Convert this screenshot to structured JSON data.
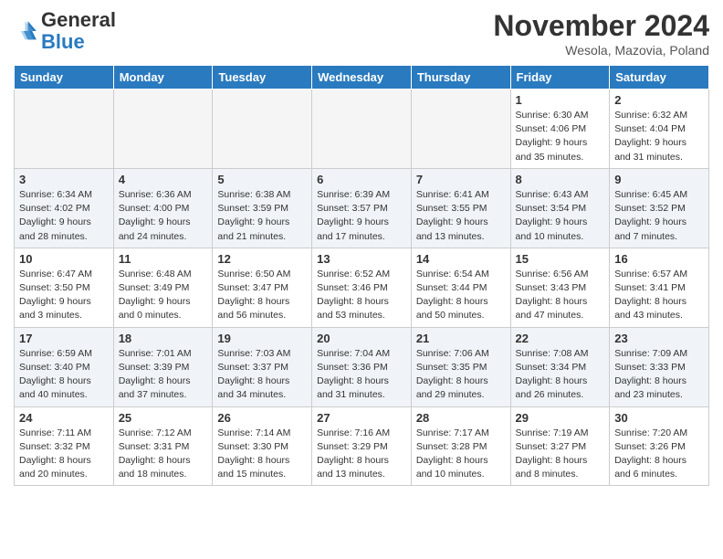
{
  "header": {
    "logo_line1": "General",
    "logo_line2": "Blue",
    "month": "November 2024",
    "location": "Wesola, Mazovia, Poland"
  },
  "days_of_week": [
    "Sunday",
    "Monday",
    "Tuesday",
    "Wednesday",
    "Thursday",
    "Friday",
    "Saturday"
  ],
  "weeks": [
    {
      "days": [
        {
          "num": "",
          "info": "",
          "empty": true
        },
        {
          "num": "",
          "info": "",
          "empty": true
        },
        {
          "num": "",
          "info": "",
          "empty": true
        },
        {
          "num": "",
          "info": "",
          "empty": true
        },
        {
          "num": "",
          "info": "",
          "empty": true
        },
        {
          "num": "1",
          "info": "Sunrise: 6:30 AM\nSunset: 4:06 PM\nDaylight: 9 hours\nand 35 minutes."
        },
        {
          "num": "2",
          "info": "Sunrise: 6:32 AM\nSunset: 4:04 PM\nDaylight: 9 hours\nand 31 minutes."
        }
      ]
    },
    {
      "days": [
        {
          "num": "3",
          "info": "Sunrise: 6:34 AM\nSunset: 4:02 PM\nDaylight: 9 hours\nand 28 minutes."
        },
        {
          "num": "4",
          "info": "Sunrise: 6:36 AM\nSunset: 4:00 PM\nDaylight: 9 hours\nand 24 minutes."
        },
        {
          "num": "5",
          "info": "Sunrise: 6:38 AM\nSunset: 3:59 PM\nDaylight: 9 hours\nand 21 minutes."
        },
        {
          "num": "6",
          "info": "Sunrise: 6:39 AM\nSunset: 3:57 PM\nDaylight: 9 hours\nand 17 minutes."
        },
        {
          "num": "7",
          "info": "Sunrise: 6:41 AM\nSunset: 3:55 PM\nDaylight: 9 hours\nand 13 minutes."
        },
        {
          "num": "8",
          "info": "Sunrise: 6:43 AM\nSunset: 3:54 PM\nDaylight: 9 hours\nand 10 minutes."
        },
        {
          "num": "9",
          "info": "Sunrise: 6:45 AM\nSunset: 3:52 PM\nDaylight: 9 hours\nand 7 minutes."
        }
      ]
    },
    {
      "days": [
        {
          "num": "10",
          "info": "Sunrise: 6:47 AM\nSunset: 3:50 PM\nDaylight: 9 hours\nand 3 minutes."
        },
        {
          "num": "11",
          "info": "Sunrise: 6:48 AM\nSunset: 3:49 PM\nDaylight: 9 hours\nand 0 minutes."
        },
        {
          "num": "12",
          "info": "Sunrise: 6:50 AM\nSunset: 3:47 PM\nDaylight: 8 hours\nand 56 minutes."
        },
        {
          "num": "13",
          "info": "Sunrise: 6:52 AM\nSunset: 3:46 PM\nDaylight: 8 hours\nand 53 minutes."
        },
        {
          "num": "14",
          "info": "Sunrise: 6:54 AM\nSunset: 3:44 PM\nDaylight: 8 hours\nand 50 minutes."
        },
        {
          "num": "15",
          "info": "Sunrise: 6:56 AM\nSunset: 3:43 PM\nDaylight: 8 hours\nand 47 minutes."
        },
        {
          "num": "16",
          "info": "Sunrise: 6:57 AM\nSunset: 3:41 PM\nDaylight: 8 hours\nand 43 minutes."
        }
      ]
    },
    {
      "days": [
        {
          "num": "17",
          "info": "Sunrise: 6:59 AM\nSunset: 3:40 PM\nDaylight: 8 hours\nand 40 minutes."
        },
        {
          "num": "18",
          "info": "Sunrise: 7:01 AM\nSunset: 3:39 PM\nDaylight: 8 hours\nand 37 minutes."
        },
        {
          "num": "19",
          "info": "Sunrise: 7:03 AM\nSunset: 3:37 PM\nDaylight: 8 hours\nand 34 minutes."
        },
        {
          "num": "20",
          "info": "Sunrise: 7:04 AM\nSunset: 3:36 PM\nDaylight: 8 hours\nand 31 minutes."
        },
        {
          "num": "21",
          "info": "Sunrise: 7:06 AM\nSunset: 3:35 PM\nDaylight: 8 hours\nand 29 minutes."
        },
        {
          "num": "22",
          "info": "Sunrise: 7:08 AM\nSunset: 3:34 PM\nDaylight: 8 hours\nand 26 minutes."
        },
        {
          "num": "23",
          "info": "Sunrise: 7:09 AM\nSunset: 3:33 PM\nDaylight: 8 hours\nand 23 minutes."
        }
      ]
    },
    {
      "days": [
        {
          "num": "24",
          "info": "Sunrise: 7:11 AM\nSunset: 3:32 PM\nDaylight: 8 hours\nand 20 minutes."
        },
        {
          "num": "25",
          "info": "Sunrise: 7:12 AM\nSunset: 3:31 PM\nDaylight: 8 hours\nand 18 minutes."
        },
        {
          "num": "26",
          "info": "Sunrise: 7:14 AM\nSunset: 3:30 PM\nDaylight: 8 hours\nand 15 minutes."
        },
        {
          "num": "27",
          "info": "Sunrise: 7:16 AM\nSunset: 3:29 PM\nDaylight: 8 hours\nand 13 minutes."
        },
        {
          "num": "28",
          "info": "Sunrise: 7:17 AM\nSunset: 3:28 PM\nDaylight: 8 hours\nand 10 minutes."
        },
        {
          "num": "29",
          "info": "Sunrise: 7:19 AM\nSunset: 3:27 PM\nDaylight: 8 hours\nand 8 minutes."
        },
        {
          "num": "30",
          "info": "Sunrise: 7:20 AM\nSunset: 3:26 PM\nDaylight: 8 hours\nand 6 minutes."
        }
      ]
    }
  ]
}
